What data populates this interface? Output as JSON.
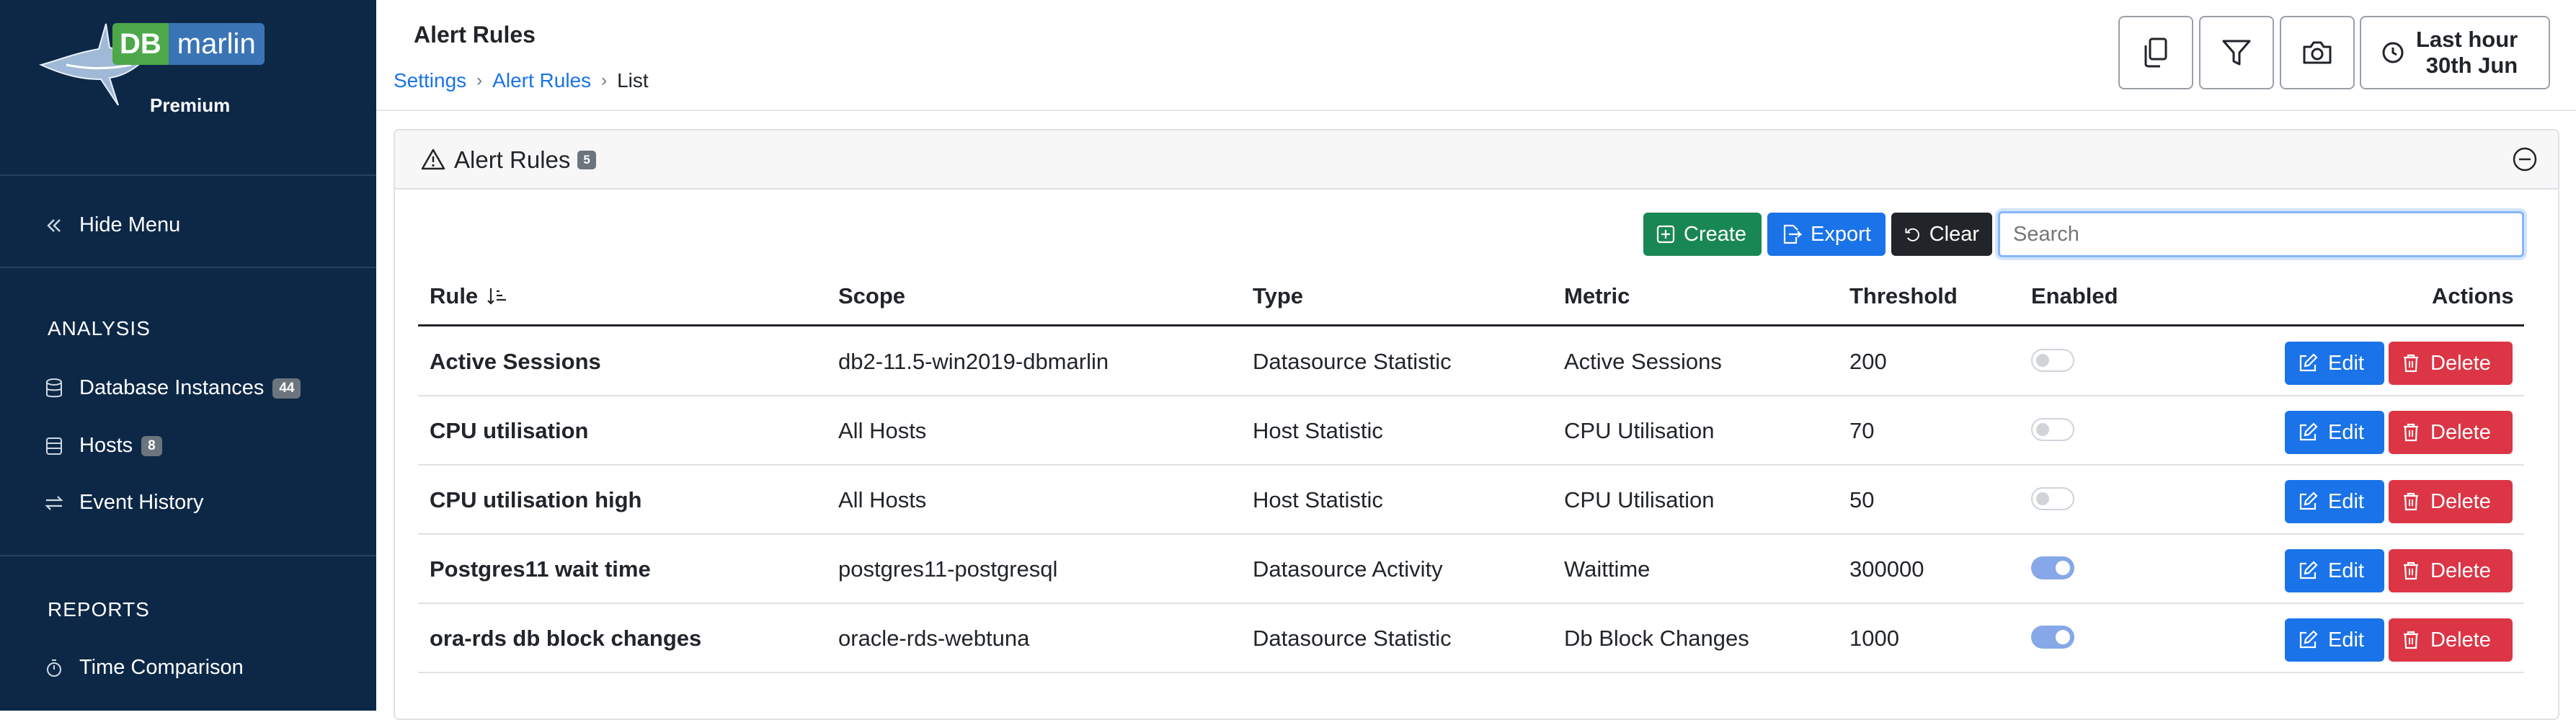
{
  "brand": {
    "db": "DB",
    "name": "marlin",
    "tier": "Premium"
  },
  "sidebar": {
    "hide_menu": "Hide Menu",
    "analysis_heading": "ANALYSIS",
    "analysis_items": [
      {
        "label": "Database Instances",
        "badge": "44",
        "icon": "database-icon"
      },
      {
        "label": "Hosts",
        "badge": "8",
        "icon": "server-icon"
      },
      {
        "label": "Event History",
        "icon": "arrows-exchange-icon"
      }
    ],
    "reports_heading": "REPORTS",
    "reports_items": [
      {
        "label": "Time Comparison",
        "icon": "stopwatch-icon"
      }
    ]
  },
  "header": {
    "title": "Alert Rules",
    "breadcrumb": [
      "Settings",
      "Alert Rules",
      "List"
    ],
    "time_range": {
      "line1": "Last hour",
      "line2": "30th Jun"
    }
  },
  "card": {
    "title": "Alert Rules",
    "count": "5",
    "buttons": {
      "create": "Create",
      "export": "Export",
      "clear": "Clear"
    },
    "search_placeholder": "Search"
  },
  "table": {
    "columns": [
      "Rule",
      "Scope",
      "Type",
      "Metric",
      "Threshold",
      "Enabled",
      "Actions"
    ],
    "rows": [
      {
        "rule": "Active Sessions",
        "scope": "db2-11.5-win2019-dbmarlin",
        "type": "Datasource Statistic",
        "metric": "Active Sessions",
        "threshold": "200",
        "enabled": false
      },
      {
        "rule": "CPU utilisation",
        "scope": "All Hosts",
        "type": "Host Statistic",
        "metric": "CPU Utilisation",
        "threshold": "70",
        "enabled": false
      },
      {
        "rule": "CPU utilisation high",
        "scope": "All Hosts",
        "type": "Host Statistic",
        "metric": "CPU Utilisation",
        "threshold": "50",
        "enabled": false
      },
      {
        "rule": "Postgres11 wait time",
        "scope": "postgres11-postgresql",
        "type": "Datasource Activity",
        "metric": "Waittime",
        "threshold": "300000",
        "enabled": true
      },
      {
        "rule": "ora-rds db block changes",
        "scope": "oracle-rds-webtuna",
        "type": "Datasource Statistic",
        "metric": "Db Block Changes",
        "threshold": "1000",
        "enabled": true
      }
    ],
    "edit_label": "Edit",
    "delete_label": "Delete"
  },
  "colors": {
    "sidebar": "#0d2847",
    "create": "#198754",
    "export": "#1a73e8",
    "clear": "#212529",
    "delete": "#dc3545",
    "link": "#1a73e8"
  }
}
